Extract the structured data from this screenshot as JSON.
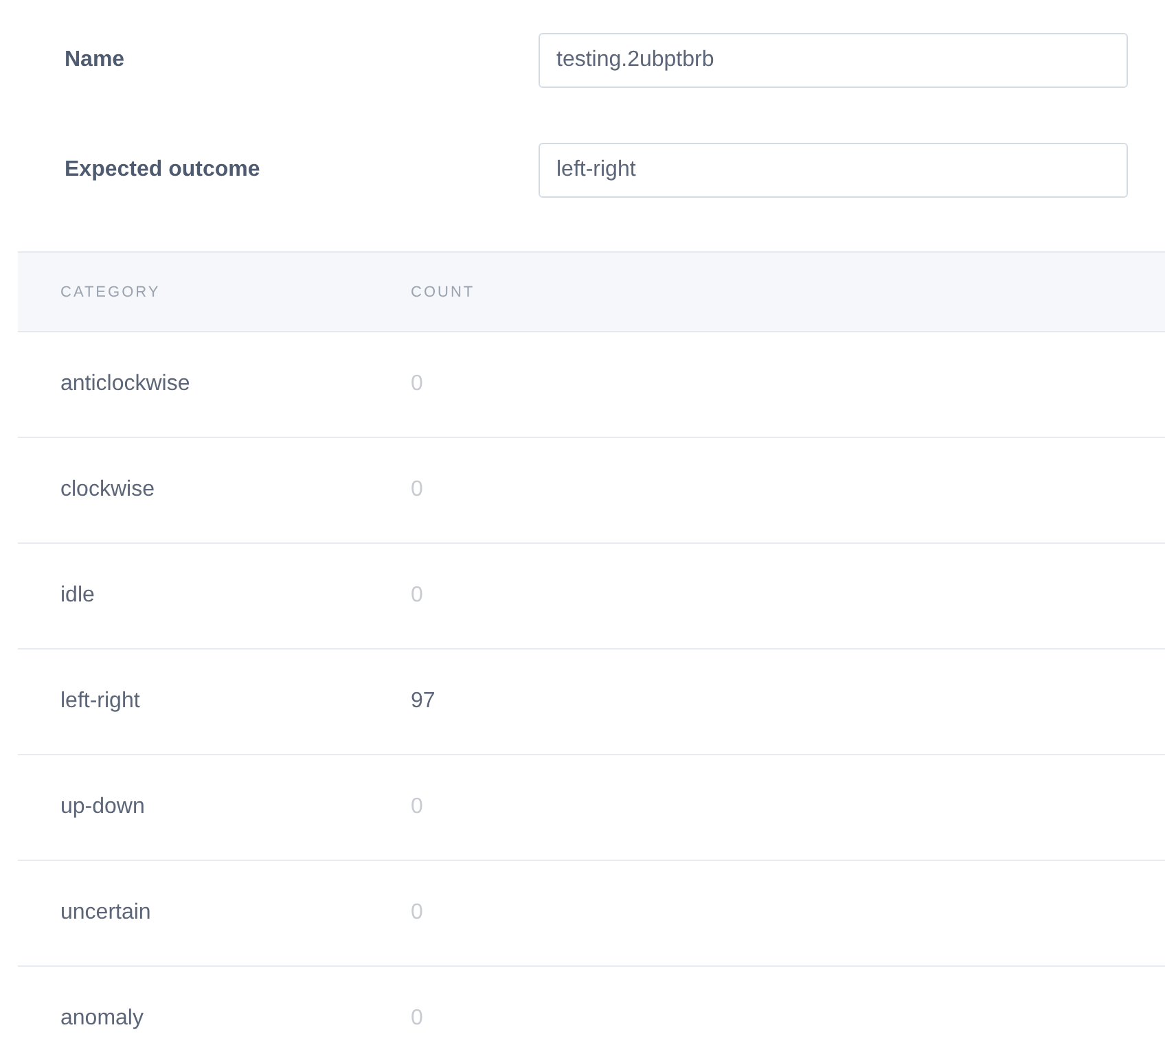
{
  "fields": [
    {
      "label": "Name",
      "value": "testing.2ubptbrb"
    },
    {
      "label": "Expected outcome",
      "value": "left-right"
    }
  ],
  "table": {
    "columns": [
      "CATEGORY",
      "COUNT"
    ],
    "rows": [
      {
        "category": "anticlockwise",
        "count": "0",
        "dimmed": true
      },
      {
        "category": "clockwise",
        "count": "0",
        "dimmed": true
      },
      {
        "category": "idle",
        "count": "0",
        "dimmed": true
      },
      {
        "category": "left-right",
        "count": "97",
        "dimmed": false
      },
      {
        "category": "up-down",
        "count": "0",
        "dimmed": true
      },
      {
        "category": "uncertain",
        "count": "0",
        "dimmed": true
      },
      {
        "category": "anomaly",
        "count": "0",
        "dimmed": true
      }
    ]
  }
}
